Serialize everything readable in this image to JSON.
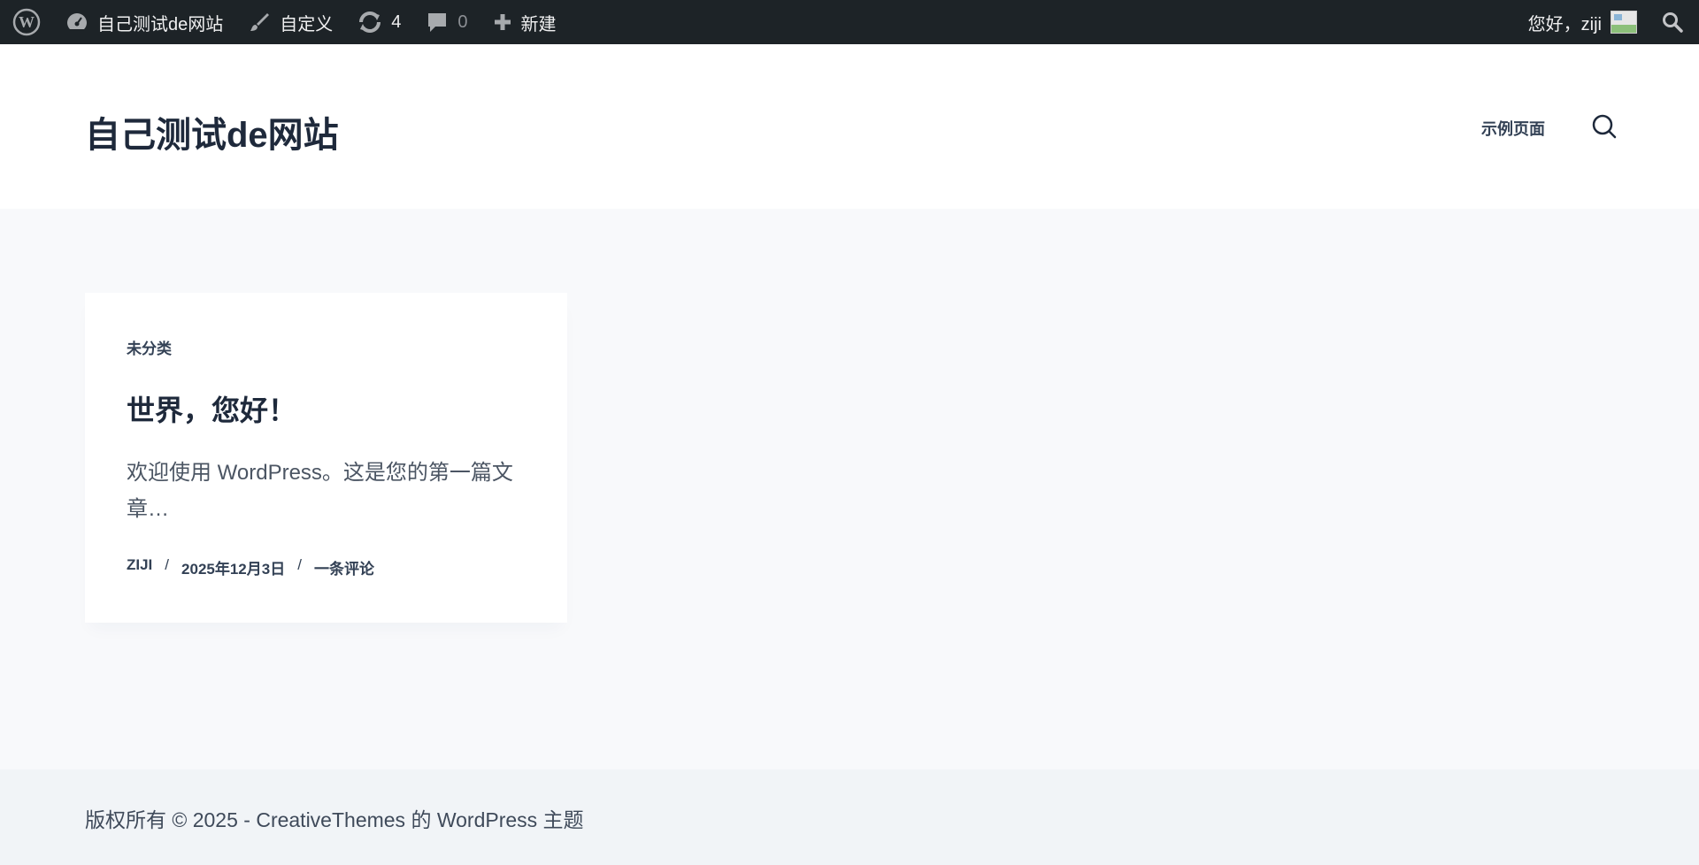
{
  "admin_bar": {
    "site_name": "自己测试de网站",
    "customize": "自定义",
    "updates_count": "4",
    "comments_count": "0",
    "new": "新建",
    "greeting": "您好，ziji"
  },
  "header": {
    "site_title": "自己测试de网站",
    "nav_items": [
      {
        "label": "示例页面"
      }
    ]
  },
  "post": {
    "category": "未分类",
    "title": "世界，您好！",
    "excerpt": "欢迎使用 WordPress。这是您的第一篇文章…",
    "author": "ZIJI",
    "date": "2025年12月3日",
    "comments": "一条评论",
    "separator": "/"
  },
  "footer": {
    "copyright": "版权所有 © 2025 - CreativeThemes 的 WordPress 主题"
  },
  "colors": {
    "admin_bar_bg": "#1d2327",
    "header_bg": "#ffffff",
    "body_bg": "#f8f9fb",
    "footer_bg": "#f1f4f7",
    "text_dark": "#1e293b"
  }
}
